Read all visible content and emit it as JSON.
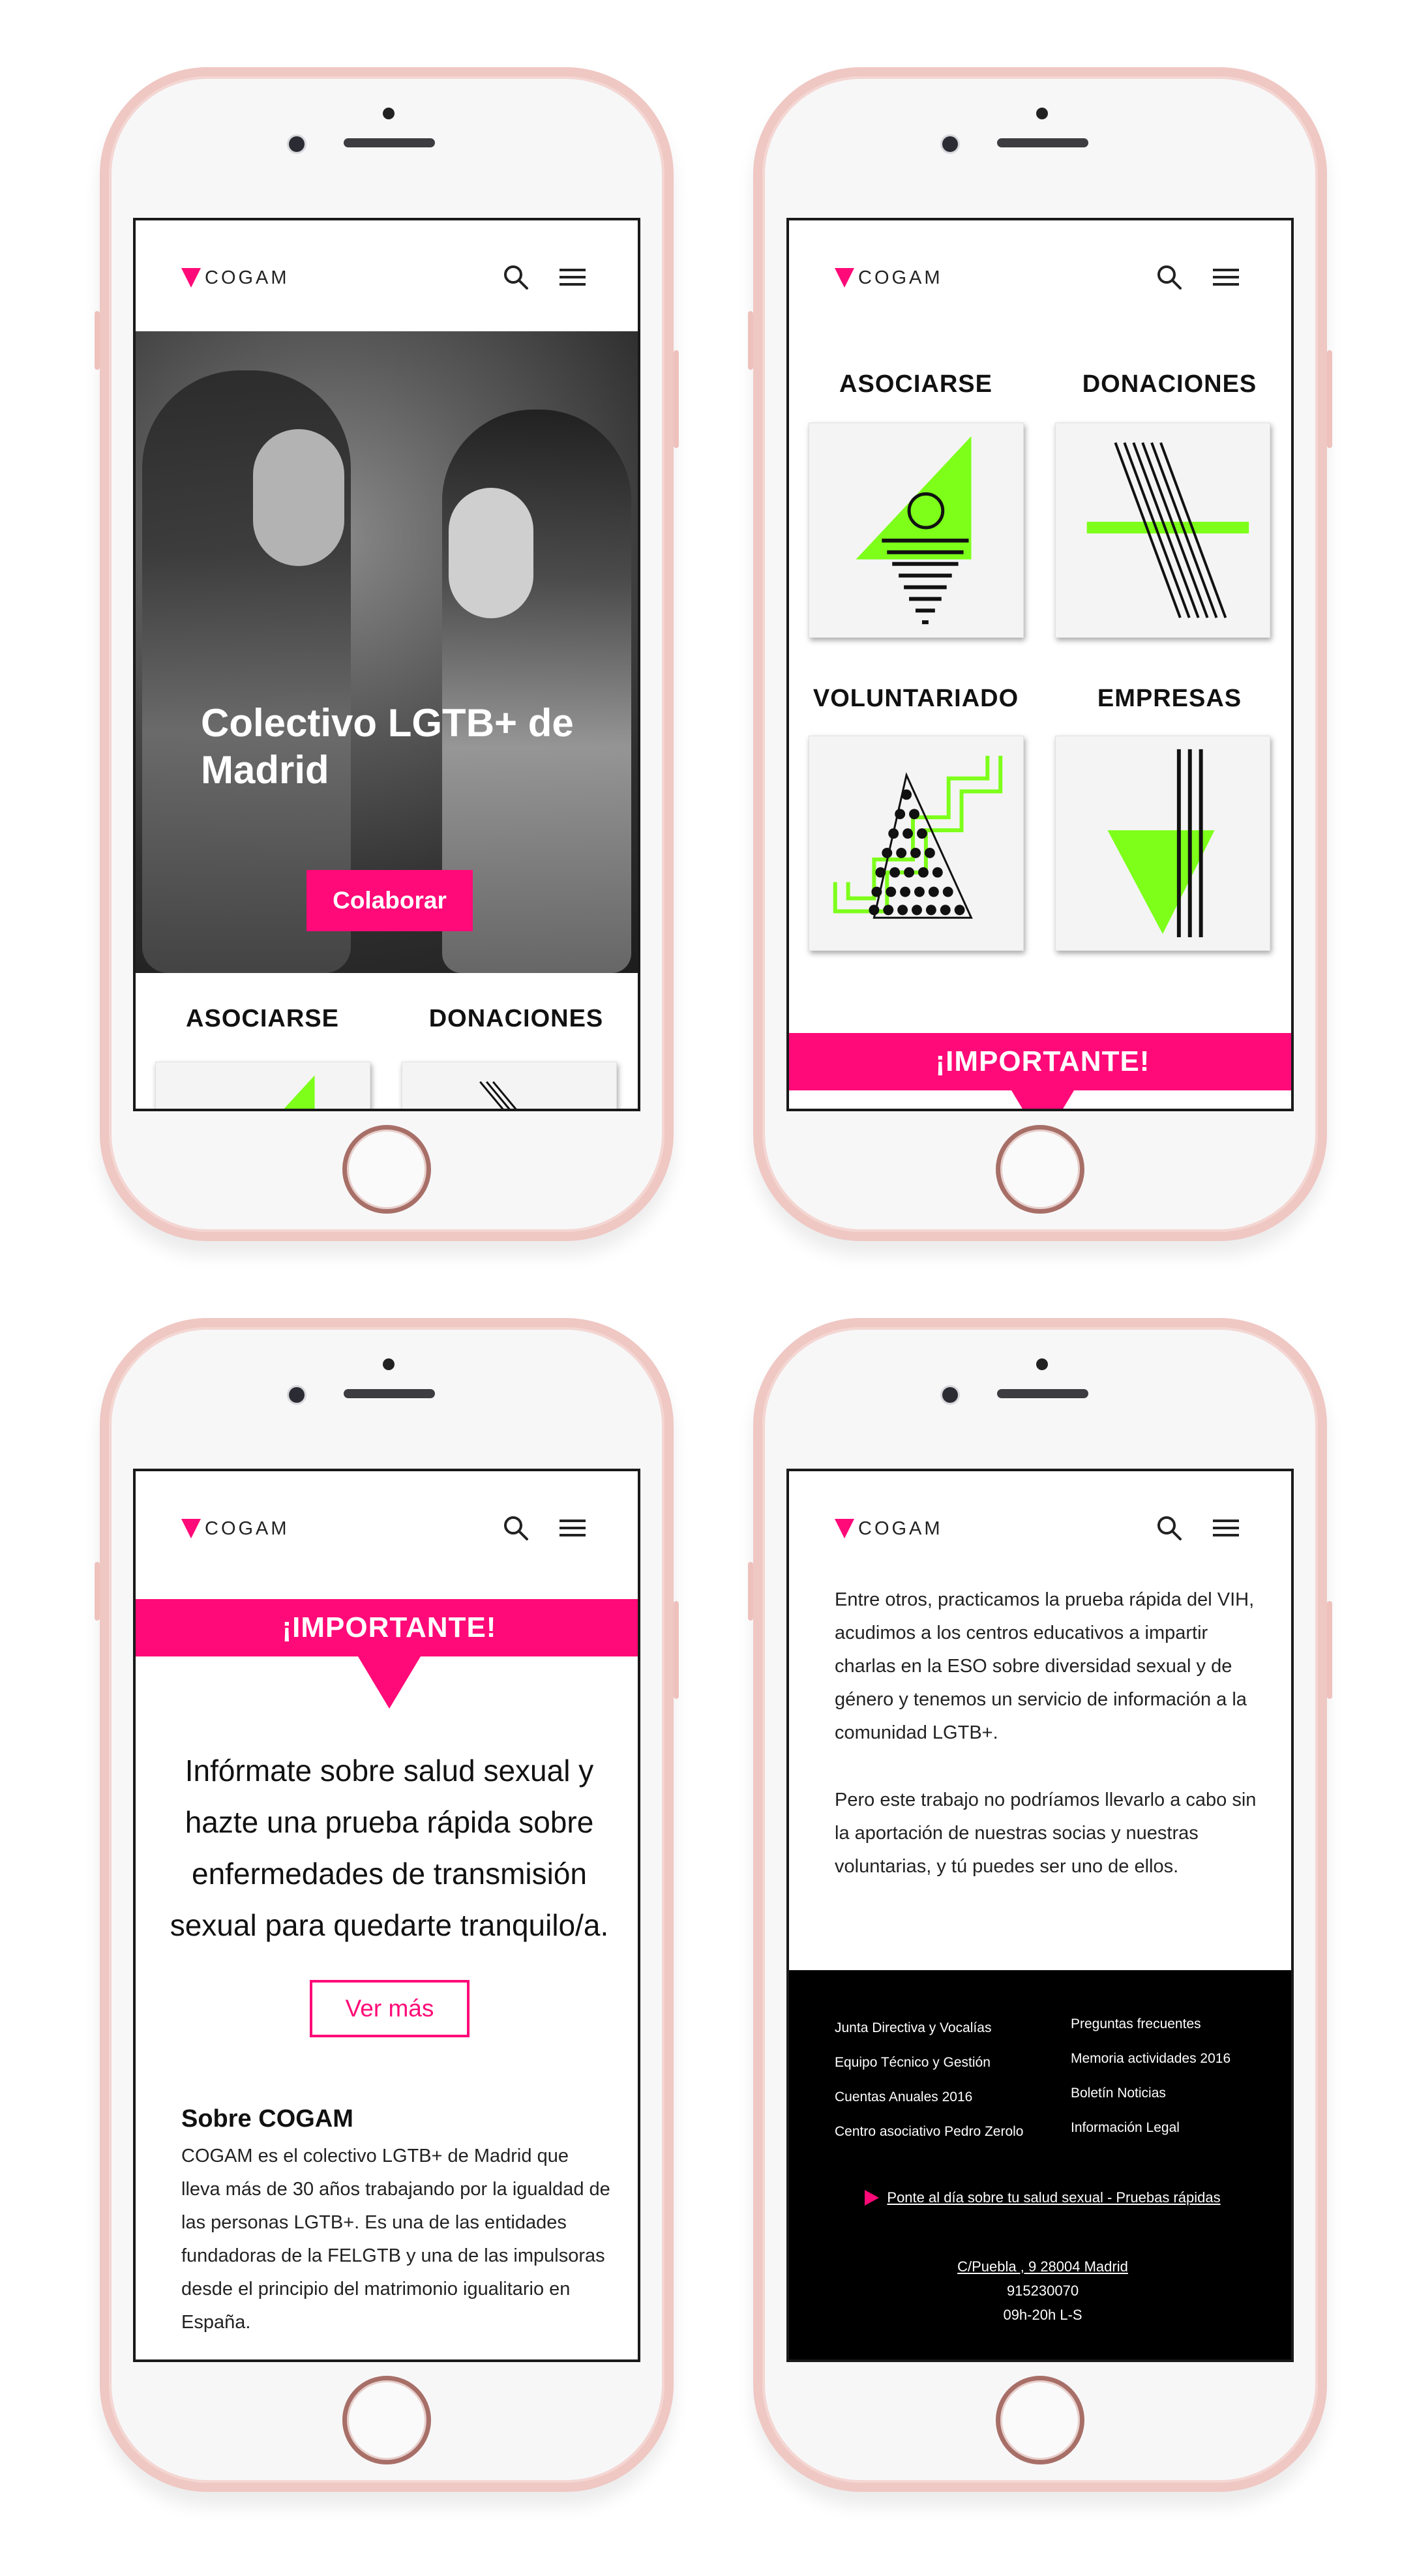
{
  "brand": {
    "name": "COGAM",
    "accent": "#ff0a78",
    "green": "#7dff1a"
  },
  "hero": {
    "title": "Colectivo LGTB+ de Madrid",
    "button": "Colaborar"
  },
  "tiles": [
    {
      "label": "ASOCIARSE"
    },
    {
      "label": "DONACIONES"
    },
    {
      "label": "VOLUNTARIADO"
    },
    {
      "label": "EMPRESAS"
    }
  ],
  "important": {
    "title": "¡IMPORTANTE!",
    "text": "Infórmate sobre salud sexual y hazte una prueba rápida sobre enfermedades de transmisión sexual para quedarte tranquilo/a.",
    "button": "Ver más"
  },
  "about": {
    "title": "Sobre COGAM",
    "text": "COGAM es el colectivo LGTB+ de Madrid que lleva más de 30 años trabajando por la igualdad de las personas LGTB+. Es una de las entidades fundadoras de la FELGTB y una de las impulsoras desde el principio del matrimonio igualitario en España.",
    "paragraph1": "Entre otros, practicamos la prueba rápida del VIH, acudimos a los centros educativos a impartir charlas en la ESO sobre diversidad sexual y de género y tenemos un servicio de información a la comunidad LGTB+.",
    "paragraph2": "Pero este trabajo no podríamos llevarlo a cabo sin la aportación de nuestras socias y nuestras voluntarias, y tú puedes ser uno de ellos."
  },
  "footer": {
    "col1": [
      "Junta Directiva y Vocalías",
      "Equipo Técnico y Gestión",
      "Cuentas Anuales 2016",
      "Centro asociativo Pedro Zerolo"
    ],
    "col2": [
      "Preguntas frecuentes",
      "Memoria actividades 2016",
      "Boletín Noticias",
      "Información Legal"
    ],
    "cta": "Ponte al día sobre tu salud sexual - Pruebas rápidas",
    "address": "C/Puebla , 9 28004 Madrid",
    "phone": "915230070",
    "hours": "09h-20h L-S"
  }
}
